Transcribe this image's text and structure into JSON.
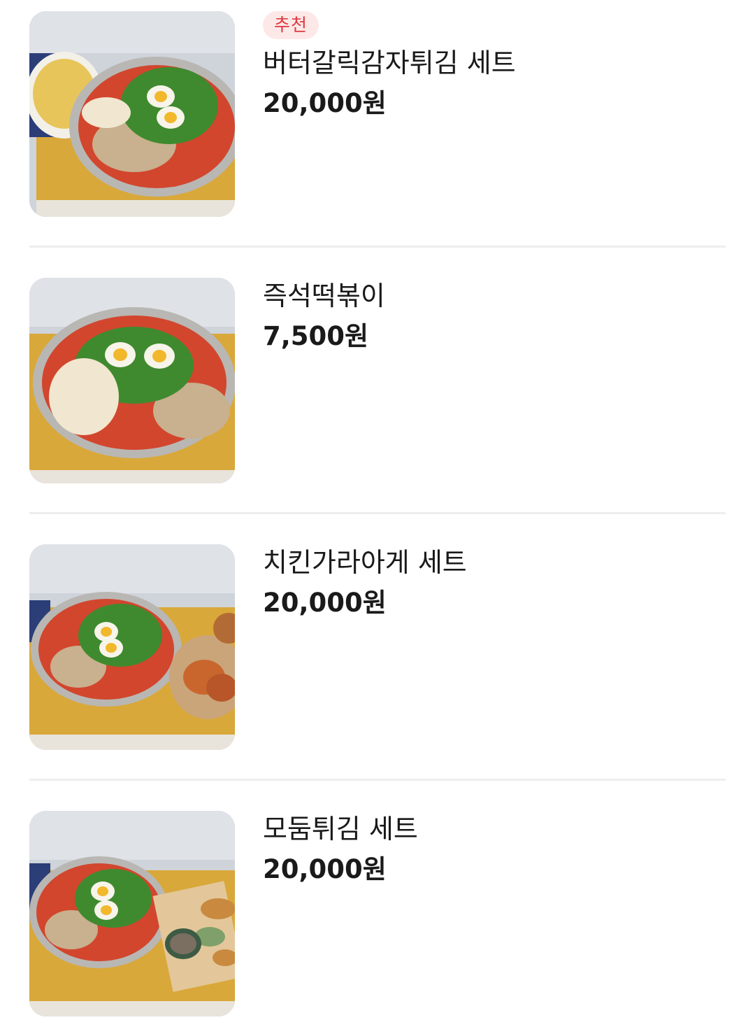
{
  "menu": {
    "items": [
      {
        "badge": "추천",
        "name": "버터갈릭감자튀김 세트",
        "price": "20,000원",
        "image": "tteokbokki-with-butter-garlic-fries-photo"
      },
      {
        "name": "즉석떡볶이",
        "price": "7,500원",
        "image": "tteokbokki-pot-photo"
      },
      {
        "name": "치킨가라아게 세트",
        "price": "20,000원",
        "image": "tteokbokki-with-chicken-karaage-photo"
      },
      {
        "name": "모둠튀김 세트",
        "price": "20,000원",
        "image": "tteokbokki-with-assorted-fried-photo"
      }
    ]
  },
  "colors": {
    "badge_bg": "#fde8e8",
    "badge_text": "#e0393e",
    "divider": "#eeeeee",
    "text": "#1a1a1a"
  }
}
